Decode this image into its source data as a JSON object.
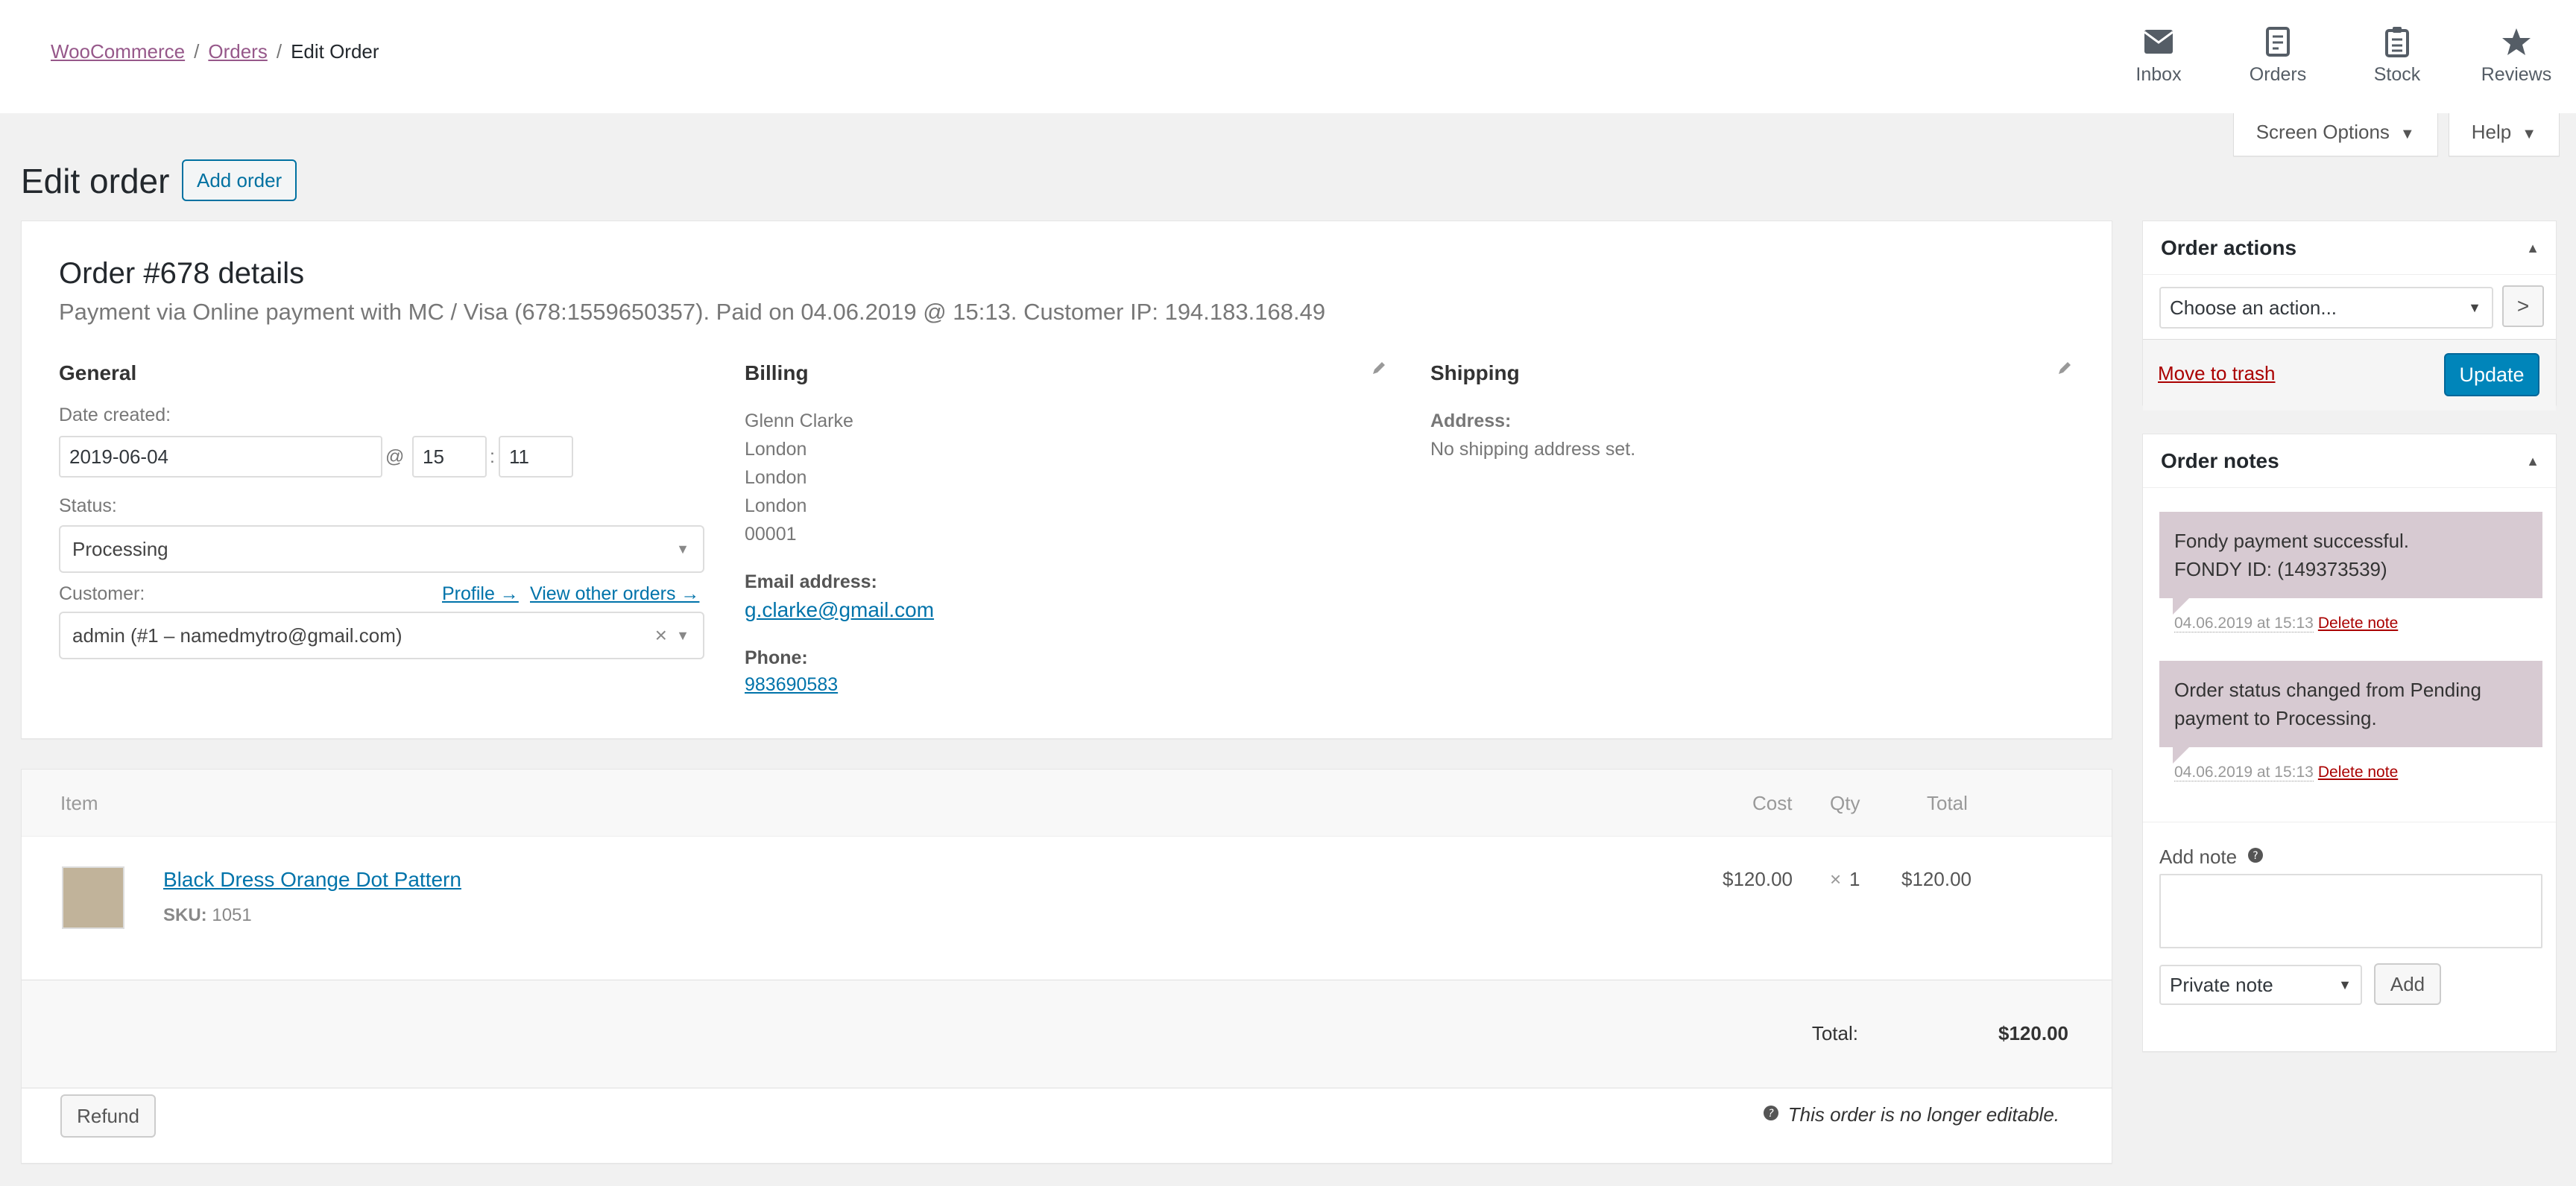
{
  "breadcrumb": {
    "root": "WooCommerce",
    "orders": "Orders",
    "current": "Edit Order",
    "separator": "/"
  },
  "topnav": [
    {
      "label": "Inbox",
      "icon": "inbox-icon"
    },
    {
      "label": "Orders",
      "icon": "orders-icon"
    },
    {
      "label": "Stock",
      "icon": "stock-icon"
    },
    {
      "label": "Reviews",
      "icon": "star-icon"
    }
  ],
  "screen_tabs": {
    "screen_options": "Screen Options",
    "help": "Help"
  },
  "page": {
    "title": "Edit order",
    "add_order": "Add order"
  },
  "order": {
    "heading": "Order #678 details",
    "meta": "Payment via Online payment with MC / Visa (678:1559650357). Paid on 04.06.2019 @ 15:13. Customer IP: 194.183.168.49",
    "general": {
      "title": "General",
      "date_label": "Date created:",
      "date": "2019-06-04",
      "at": "@",
      "hour": "15",
      "colon": ":",
      "minute": "11",
      "status_label": "Status:",
      "status": "Processing",
      "customer_label": "Customer:",
      "profile_link": "Profile →",
      "other_orders_link": "View other orders →",
      "customer": "admin (#1 – namedmytro@gmail.com)",
      "clear": "×"
    },
    "billing": {
      "title": "Billing",
      "lines": [
        "Glenn Clarke",
        "London",
        "London",
        "London",
        "00001"
      ],
      "email_label": "Email address:",
      "email": "g.clarke@gmail.com",
      "phone_label": "Phone:",
      "phone": "983690583"
    },
    "shipping": {
      "title": "Shipping",
      "address_label": "Address:",
      "address": "No shipping address set."
    }
  },
  "items": {
    "headers": {
      "item": "Item",
      "cost": "Cost",
      "qty": "Qty",
      "total": "Total"
    },
    "rows": [
      {
        "name": "Black Dress Orange Dot Pattern",
        "sku_label": "SKU:",
        "sku": "1051",
        "cost": "$120.00",
        "qty_x": "×",
        "qty": "1",
        "total": "$120.00"
      }
    ],
    "total_label": "Total:",
    "total_value": "$120.00",
    "refund": "Refund",
    "not_editable": "This order is no longer editable."
  },
  "order_actions": {
    "title": "Order actions",
    "select_placeholder": "Choose an action...",
    "go": ">",
    "trash": "Move to trash",
    "update": "Update"
  },
  "order_notes": {
    "title": "Order notes",
    "notes": [
      {
        "line1": "Fondy payment successful.",
        "line2": "FONDY ID: (149373539)",
        "date": "04.06.2019 at 15:13",
        "delete": "Delete note"
      },
      {
        "line1": "Order status changed from Pending",
        "line2": "payment to Processing.",
        "date": "04.06.2019 at 15:13",
        "delete": "Delete note"
      }
    ],
    "add_note_label": "Add note",
    "note_type": "Private note",
    "add": "Add"
  },
  "colors": {
    "accent": "#0085ba",
    "link": "#0073aa",
    "woo_purple": "#96588a",
    "note_bg": "#d7cad2",
    "danger": "#a00"
  }
}
